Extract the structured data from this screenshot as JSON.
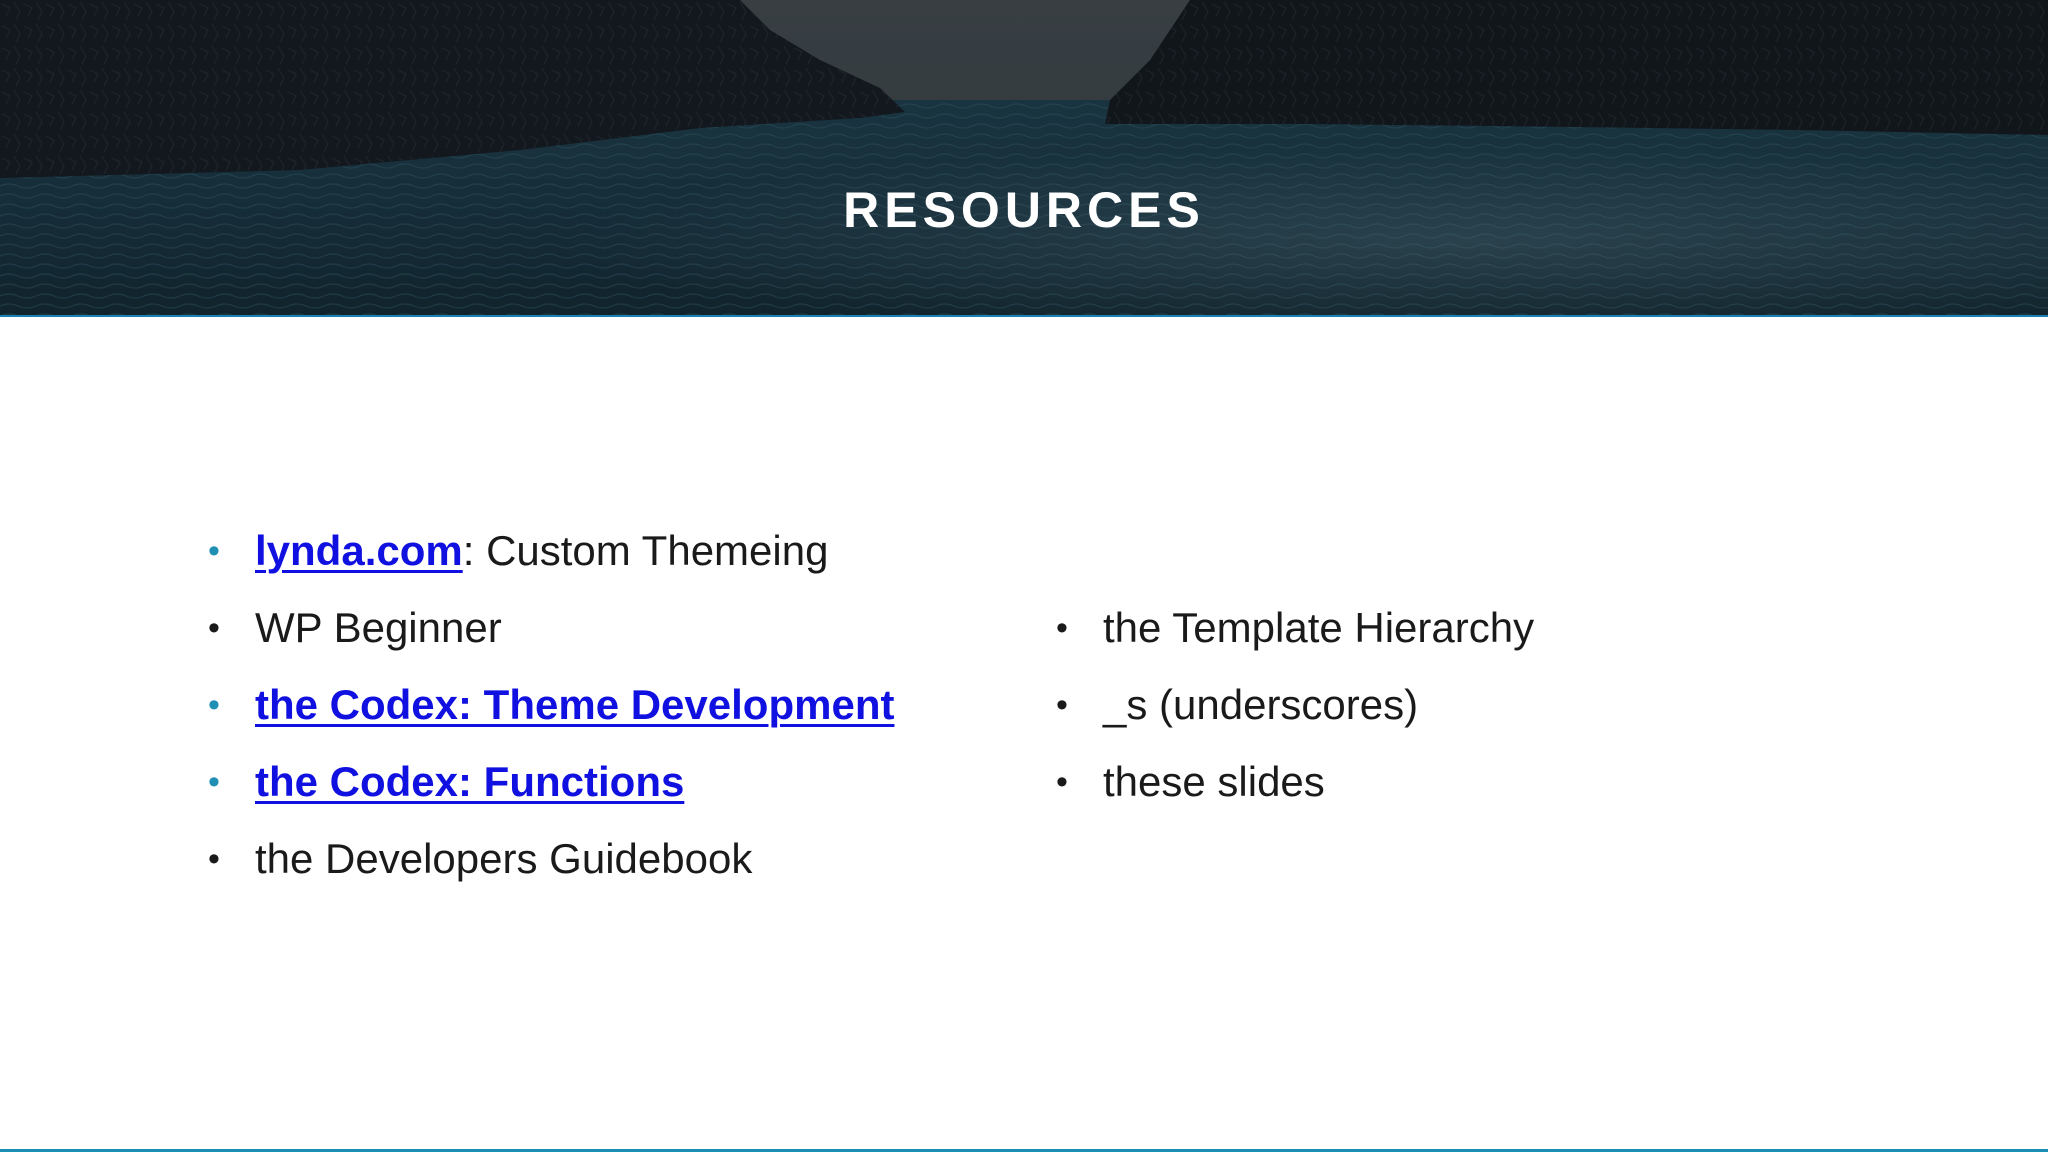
{
  "slide": {
    "title": "RESOURCES",
    "left_items": [
      {
        "link": "lynda.com",
        "text": ": Custom Themeing"
      },
      {
        "link": "",
        "text": "WP Beginner"
      },
      {
        "link": "the Codex: Theme Development",
        "text": ""
      },
      {
        "link": "the Codex: Functions",
        "text": ""
      },
      {
        "link": "",
        "text": "the Developers Guidebook"
      }
    ],
    "right_items": [
      {
        "text": "the Template Hierarchy"
      },
      {
        "text": "_s (underscores)"
      },
      {
        "text": "these slides"
      }
    ],
    "bullet_char": "•"
  },
  "colors": {
    "link": "#1010e0",
    "accent_bullet": "#1f8fb4",
    "text": "#1a1a1a",
    "rule": "#1b7fb3"
  }
}
